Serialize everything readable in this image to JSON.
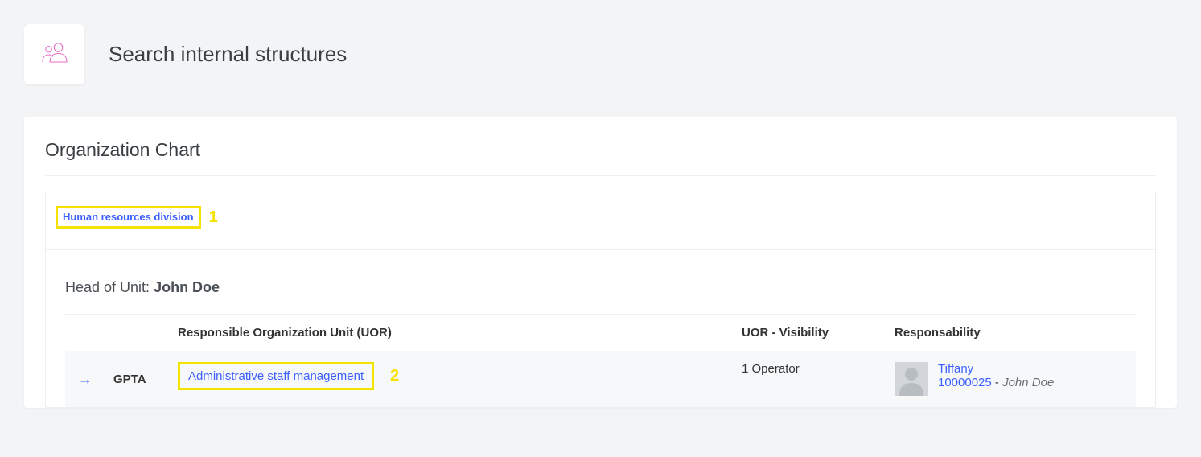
{
  "header": {
    "title": "Search internal structures"
  },
  "section": {
    "title": "Organization Chart"
  },
  "breadcrumb": {
    "label": "Human resources division",
    "annotation": "1"
  },
  "unitHead": {
    "prefix": "Head of Unit: ",
    "name": "John Doe"
  },
  "table": {
    "columns": {
      "uor": "Responsible Organization Unit (UOR)",
      "visibility": "UOR - Visibility",
      "responsibility": "Responsability"
    },
    "rows": [
      {
        "arrow": "→",
        "code": "GPTA",
        "uor_name": "Administrative staff management",
        "annotation": "2",
        "visibility": "1 Operator",
        "resp_name": "Tiffany",
        "resp_id": "10000025",
        "resp_sep": " - ",
        "resp_person": "John Doe"
      }
    ]
  }
}
